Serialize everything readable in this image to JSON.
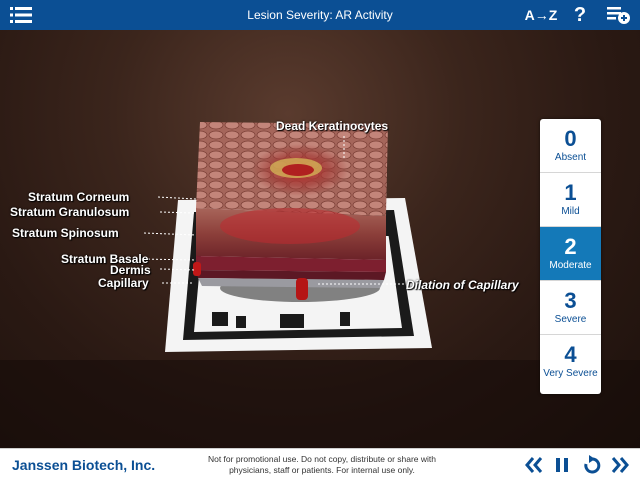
{
  "header": {
    "title": "Lesion Severity: AR Activity",
    "az_label": "A→Z",
    "help_label": "?"
  },
  "labels": {
    "dead_keratinocytes": "Dead Keratinocytes",
    "stratum_corneum": "Stratum Corneum",
    "stratum_granulosum": "Stratum Granulosum",
    "stratum_spinosum": "Stratum Spinosum",
    "stratum_basale": "Stratum Basale",
    "dermis": "Dermis",
    "capillary": "Capillary",
    "dilation_of_capillary": "Dilation of Capillary"
  },
  "severity": {
    "selected": 2,
    "items": [
      {
        "num": "0",
        "label": "Absent"
      },
      {
        "num": "1",
        "label": "Mild"
      },
      {
        "num": "2",
        "label": "Moderate"
      },
      {
        "num": "3",
        "label": "Severe"
      },
      {
        "num": "4",
        "label": "Very Severe"
      }
    ]
  },
  "footer": {
    "brand": "Janssen Biotech, Inc.",
    "disclaimer_line1": "Not for promotional use. Do not copy, distribute or share with",
    "disclaimer_line2": "physicians, staff or patients. For internal use only."
  },
  "colors": {
    "header_blue": "#0b4f94",
    "selected_blue": "#1479b8"
  }
}
